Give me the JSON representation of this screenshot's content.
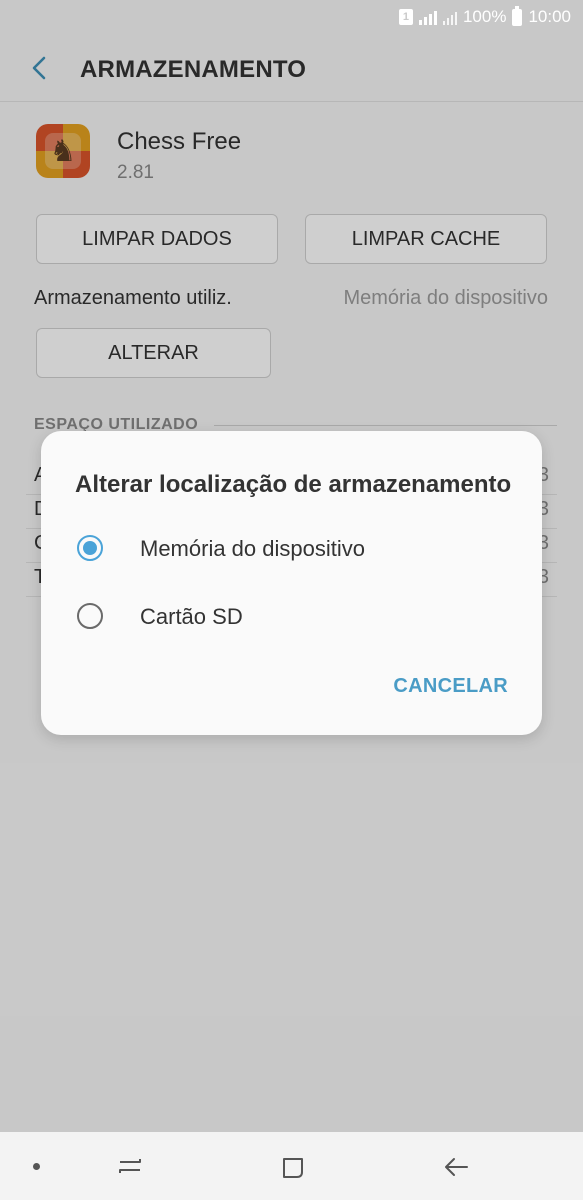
{
  "status_bar": {
    "sim_label": "1",
    "battery_text": "100%",
    "time": "10:00"
  },
  "header": {
    "back_icon": "chevron-left-icon",
    "title": "ARMAZENAMENTO"
  },
  "app": {
    "name": "Chess Free",
    "version": "2.81",
    "icon": "chess-app-icon"
  },
  "buttons": {
    "clear_data": "LIMPAR DADOS",
    "clear_cache": "LIMPAR CACHE",
    "change": "ALTERAR"
  },
  "storage": {
    "label": "Armazenamento utiliz.",
    "value": "Memória do dispositivo"
  },
  "section": {
    "title": "ESPAÇO UTILIZADO"
  },
  "usage_rows": [
    {
      "label_initial": "A",
      "value_tail": "3"
    },
    {
      "label_initial": "D",
      "value_tail": "3"
    },
    {
      "label_initial": "C",
      "value_tail": "3"
    },
    {
      "label_initial": "T",
      "value_tail": "3"
    }
  ],
  "dialog": {
    "title": "Alterar localização de armazenamento",
    "options": [
      {
        "label": "Memória do dispositivo",
        "selected": true
      },
      {
        "label": "Cartão SD",
        "selected": false
      }
    ],
    "cancel_label": "CANCELAR"
  },
  "navbar": {
    "icons": [
      "dot-icon",
      "recent-apps-icon",
      "home-icon",
      "back-arrow-icon"
    ]
  },
  "colors": {
    "accent": "#4aa3d8",
    "cancel_text": "#4a9cc6"
  }
}
